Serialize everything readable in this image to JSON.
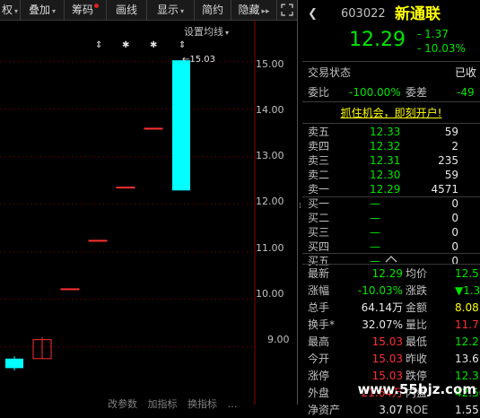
{
  "toolbar": {
    "items": [
      {
        "label": "权",
        "arrow": "▾"
      },
      {
        "label": "叠加",
        "arrow": "▾"
      },
      {
        "label": "筹码",
        "dot": true
      },
      {
        "label": "画线"
      },
      {
        "label": "显示",
        "arrow": "▾"
      },
      {
        "label": "简约"
      },
      {
        "label": "隐藏",
        "arrow": "▸▸"
      }
    ],
    "fullscreen_icon": "expand-icon"
  },
  "chart": {
    "settings_label": "设置均线",
    "settings_arrow": "▾",
    "marker_glyphs": [
      "⇕",
      "✱",
      "✱",
      "⇕"
    ],
    "y_ticks": [
      "15.00",
      "14.00",
      "13.00",
      "12.00",
      "11.00",
      "10.00",
      "9.00"
    ],
    "annotation": "←15.03",
    "bottom_tabs": [
      "改参数",
      "加指标",
      "换指标",
      "…"
    ]
  },
  "chart_data": {
    "type": "candlestick",
    "ylim": [
      8.35,
      15.6
    ],
    "candles": [
      {
        "open": 8.75,
        "close": 8.55,
        "high": 8.8,
        "low": 8.5,
        "color": "cyan"
      },
      {
        "open": 8.75,
        "close": 9.15,
        "high": 9.2,
        "low": 8.75,
        "color": "red"
      },
      {
        "open": 10.22,
        "close": 10.22,
        "high": 10.22,
        "low": 10.22,
        "color": "red"
      },
      {
        "open": 11.24,
        "close": 11.24,
        "high": 11.24,
        "low": 11.24,
        "color": "red"
      },
      {
        "open": 12.36,
        "close": 12.36,
        "high": 12.36,
        "low": 12.36,
        "color": "red"
      },
      {
        "open": 13.6,
        "close": 13.6,
        "high": 13.6,
        "low": 13.6,
        "color": "red"
      },
      {
        "open": 15.03,
        "close": 12.29,
        "high": 15.03,
        "low": 12.29,
        "color": "cyan"
      }
    ]
  },
  "panel": {
    "code": "603022",
    "name": "新通联",
    "price": "12.29",
    "change": "- 1.37",
    "change_pct": "- 10.03%",
    "trade_status_label": "交易状态",
    "trade_status_value": "已收",
    "weibi_label": "委比",
    "weibi_value": "-100.00%",
    "weicha_label": "委差",
    "weicha_value": "-49",
    "promo": "抓住机会，即刻开户!",
    "asks": [
      {
        "label": "卖五",
        "price": "12.33",
        "vol": "59"
      },
      {
        "label": "卖四",
        "price": "12.32",
        "vol": "2"
      },
      {
        "label": "卖三",
        "price": "12.31",
        "vol": "235"
      },
      {
        "label": "卖二",
        "price": "12.30",
        "vol": "59"
      },
      {
        "label": "卖一",
        "price": "12.29",
        "vol": "4571"
      }
    ],
    "bids": [
      {
        "label": "买一",
        "price": "—",
        "vol": "0"
      },
      {
        "label": "买二",
        "price": "—",
        "vol": "0"
      },
      {
        "label": "买三",
        "price": "—",
        "vol": "0"
      },
      {
        "label": "买四",
        "price": "—",
        "vol": "0"
      },
      {
        "label": "买五",
        "price": "—",
        "vol": "0"
      }
    ],
    "collapse_icon": "caret-up-icon",
    "stats": [
      {
        "l1": "最新",
        "v1": "12.29",
        "c1": "green",
        "l2": "均价",
        "v2": "12.5",
        "c2": "green"
      },
      {
        "l1": "涨幅",
        "v1": "-10.03%",
        "c1": "green",
        "l2": "涨跌",
        "v2": "▼1.3",
        "c2": "green"
      },
      {
        "l1": "总手",
        "v1": "64.14万",
        "c1": "white",
        "l2": "金额",
        "v2": "8.08",
        "c2": "yellow"
      },
      {
        "l1": "换手*",
        "v1": "32.07%",
        "c1": "white",
        "l2": "量比",
        "v2": "11.7",
        "c2": "red"
      },
      {
        "l1": "最高",
        "v1": "15.03",
        "c1": "red",
        "l2": "最低",
        "v2": "12.2",
        "c2": "green"
      },
      {
        "l1": "今开",
        "v1": "15.03",
        "c1": "red",
        "l2": "昨收",
        "v2": "13.6",
        "c2": "white"
      },
      {
        "l1": "涨停",
        "v1": "15.03",
        "c1": "red",
        "l2": "跌停",
        "v2": "12.3",
        "c2": "green"
      },
      {
        "l1": "外盘",
        "v1": "21.64万",
        "c1": "red",
        "l2": "内盘",
        "v2": "42.50",
        "c2": "green"
      },
      {
        "l1": "净资产",
        "v1": "3.07",
        "c1": "white",
        "l2": "ROE",
        "v2": "1.55",
        "c2": "white"
      }
    ],
    "watermark": "www.55bjz.com"
  },
  "colors": {
    "up": "#ff3030",
    "down": "#00ffff",
    "bg": "#000000",
    "grid": "#8b0000"
  }
}
